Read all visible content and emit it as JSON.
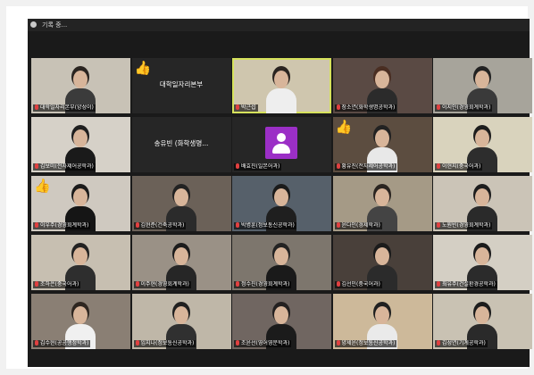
{
  "window": {
    "title": "기록 중..."
  },
  "participants": [
    {
      "name": "대학일자리본부(양성이)",
      "video": true,
      "bg": "#c8c2b6",
      "hair": "#2a2420",
      "shirt": "#3b3b3b"
    },
    {
      "name": "대학일자리본부",
      "video": false,
      "center_label": "대학일자리본부",
      "thumbs_up": true
    },
    {
      "name": "박근섭",
      "video": true,
      "active": true,
      "bg": "#cfc6ae",
      "hair": "#2a2420",
      "shirt": "#eeeeee"
    },
    {
      "name": "장소연(화학생명공학과)",
      "video": true,
      "bg": "#5a4a44",
      "hair": "#4a2e22",
      "shirt": "#2b2b2b"
    },
    {
      "name": "이지인(경영회계학과)",
      "video": true,
      "bg": "#a7a49b",
      "hair": "#222222",
      "shirt": "#3a3a3a"
    },
    {
      "name": "김보미(전자제어공학과)",
      "video": true,
      "bg": "#d6d1c8",
      "hair": "#1f1f1f",
      "shirt": "#1a1a1a"
    },
    {
      "name": "송유빈 (화학생명...",
      "video": false,
      "center_label": "송유빈 (화학생명..."
    },
    {
      "name": "배효진(일본어과)",
      "video": false,
      "avatar": true
    },
    {
      "name": "황유진(전자제어공학과)",
      "video": true,
      "bg": "#5c4d40",
      "hair": "#222222",
      "shirt": "#e8e8e8",
      "thumbs_up": true
    },
    {
      "name": "이현지(중국어과)",
      "video": true,
      "bg": "#d9d3bd",
      "hair": "#1d1d1d",
      "shirt": "#2d2d2d"
    },
    {
      "name": "이우주(경영회계학과)",
      "video": true,
      "bg": "#cfc9c0",
      "hair": "#1b1b1b",
      "shirt": "#151515",
      "thumbs_up": true
    },
    {
      "name": "김현준(건축공학과)",
      "video": true,
      "bg": "#6b6158",
      "hair": "#222222",
      "shirt": "#2b2b2b"
    },
    {
      "name": "박병훈(정보통신공학과)",
      "video": true,
      "bg": "#56606a",
      "hair": "#1b1b1b",
      "shirt": "#1f1f1f"
    },
    {
      "name": "윤다인(경제학과)",
      "video": true,
      "bg": "#a59a86",
      "hair": "#2a2420",
      "shirt": "#444444"
    },
    {
      "name": "노원빈(경영회계학과)",
      "video": true,
      "bg": "#cbc4b7",
      "hair": "#1d1d1d",
      "shirt": "#2a2a2a"
    },
    {
      "name": "조하은(중국어과)",
      "video": true,
      "bg": "#c7bfb1",
      "hair": "#222222",
      "shirt": "#2e2e2e"
    },
    {
      "name": "이주현(경영회계학과)",
      "video": true,
      "bg": "#9a9186",
      "hair": "#1c1c1c",
      "shirt": "#262626"
    },
    {
      "name": "정수진(경영회계학과)",
      "video": true,
      "bg": "#7d766d",
      "hair": "#232323",
      "shirt": "#1a1a1a"
    },
    {
      "name": "김선민(중국어과)",
      "video": true,
      "bg": "#49403a",
      "hair": "#1b1b1b",
      "shirt": "#2b2b2b"
    },
    {
      "name": "최유주(건설환경공학과)",
      "video": true,
      "bg": "#d4cfc4",
      "hair": "#1b1b1b",
      "shirt": "#2b2b2b"
    },
    {
      "name": "김수현(공공행정학과)",
      "video": true,
      "bg": "#8a7f74",
      "hair": "#2e2620",
      "shirt": "#f0f0f0"
    },
    {
      "name": "임지나(정보통신공학과)",
      "video": true,
      "bg": "#bfb7a8",
      "hair": "#202020",
      "shirt": "#303030"
    },
    {
      "name": "조윤선(영어영문학과)",
      "video": true,
      "bg": "#706661",
      "hair": "#232020",
      "shirt": "#1b1b1b"
    },
    {
      "name": "양세윤(정보통신공학과)",
      "video": true,
      "bg": "#cdb99a",
      "hair": "#202020",
      "shirt": "#eaeaea"
    },
    {
      "name": "김성연(기계공학과)",
      "video": true,
      "bg": "#c9c2b3",
      "hair": "#1c1c1c",
      "shirt": "#2a2a2a"
    }
  ]
}
